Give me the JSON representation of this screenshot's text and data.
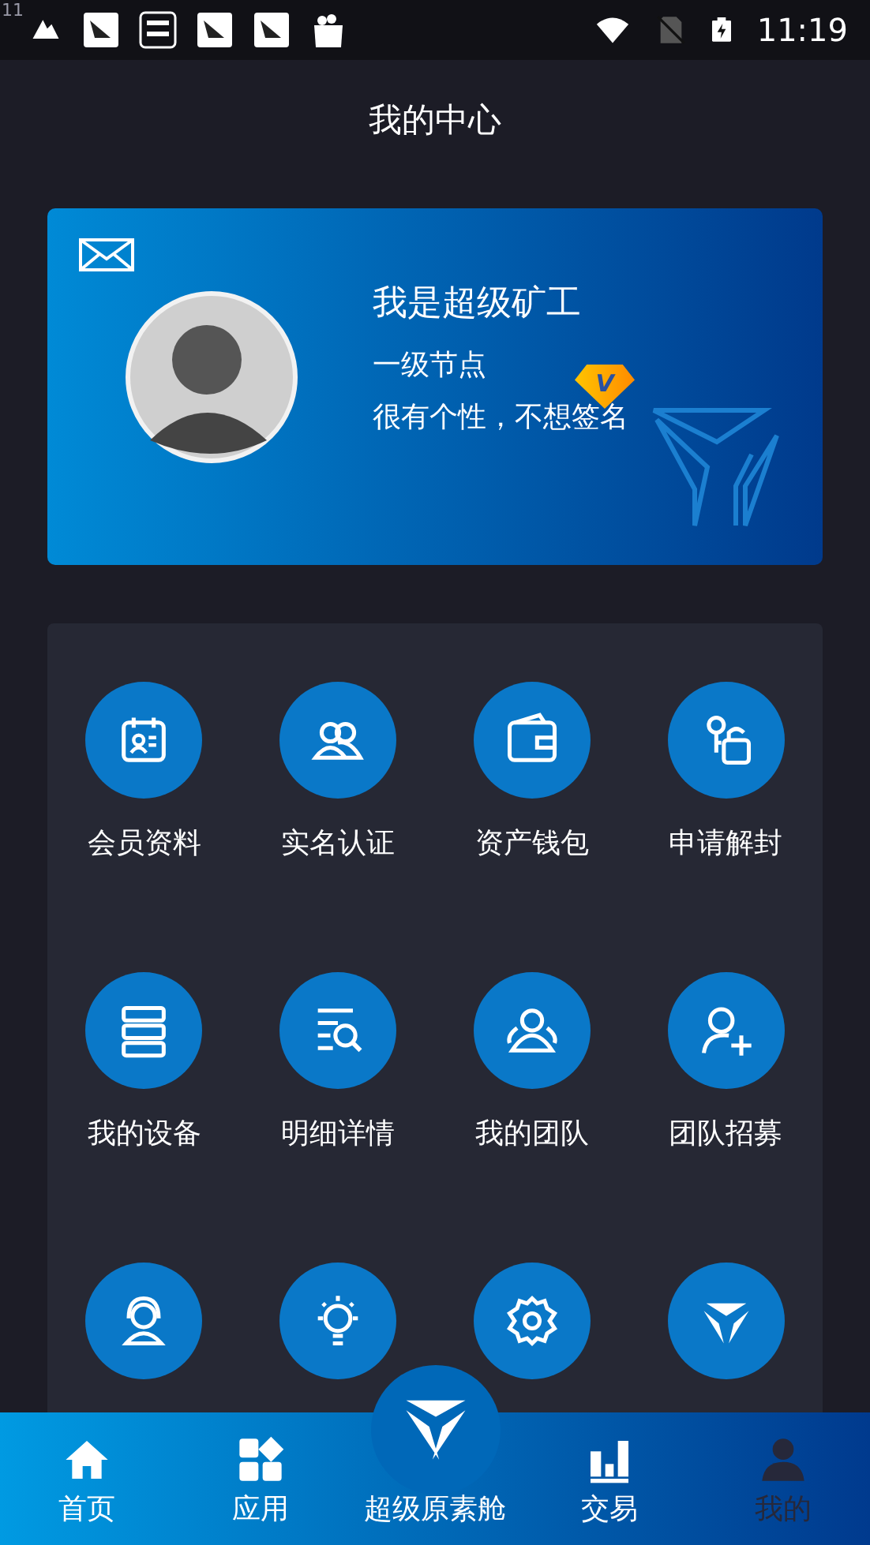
{
  "status_bar": {
    "corner_text": "11",
    "time": "11:19"
  },
  "header": {
    "title": "我的中心"
  },
  "profile": {
    "name": "我是超级矿工",
    "level": "一级节点",
    "badge": "V",
    "signature": "很有个性，不想签名"
  },
  "menu": [
    {
      "label": "会员资料"
    },
    {
      "label": "实名认证"
    },
    {
      "label": "资产钱包"
    },
    {
      "label": "申请解封"
    },
    {
      "label": "我的设备"
    },
    {
      "label": "明细详情"
    },
    {
      "label": "我的团队"
    },
    {
      "label": "团队招募"
    }
  ],
  "bottom_nav": [
    {
      "label": "首页",
      "selected": false
    },
    {
      "label": "应用",
      "selected": false
    },
    {
      "label": "超级原素舱",
      "selected": false
    },
    {
      "label": "交易",
      "selected": false
    },
    {
      "label": "我的",
      "selected": true
    }
  ]
}
